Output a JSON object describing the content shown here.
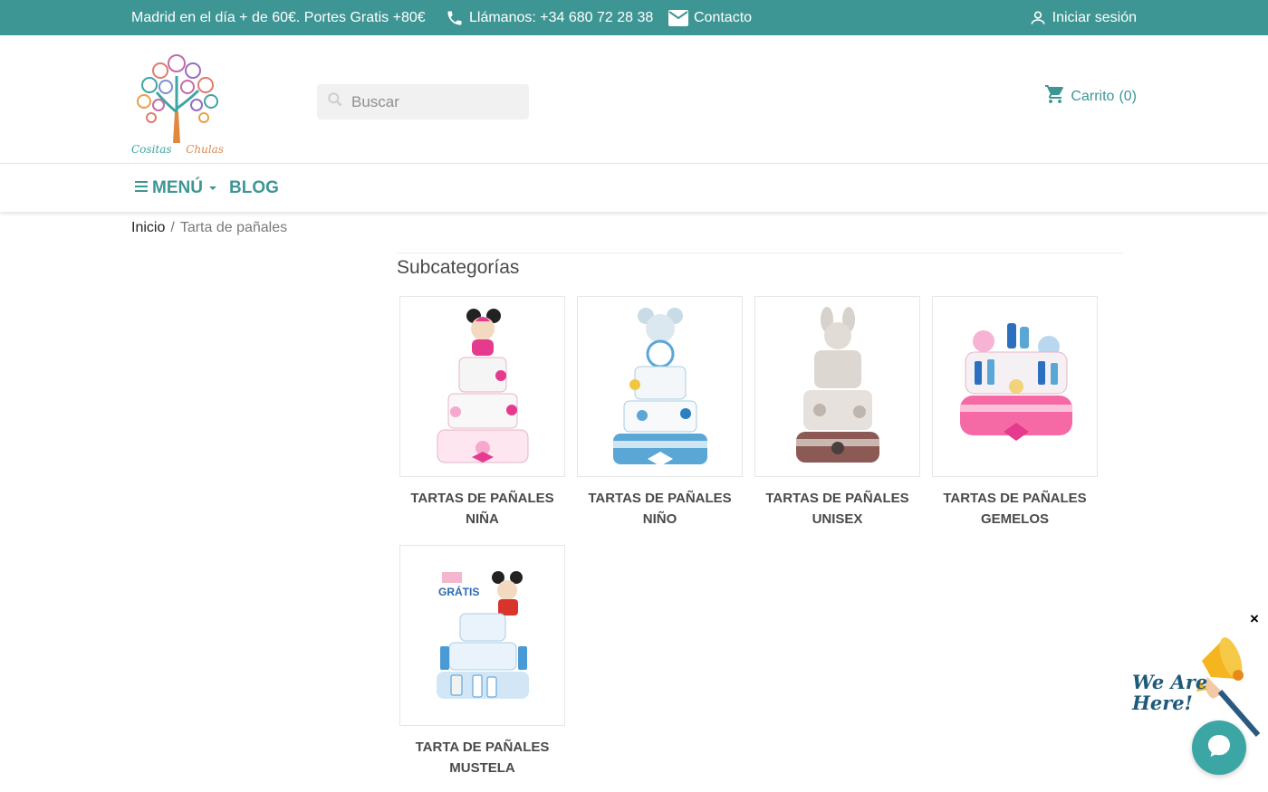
{
  "topbar": {
    "promo": "Madrid en el día + de 60€. Portes Gratis +80€",
    "phone": "Llámanos: +34 680 72 28 38",
    "contact": "Contacto",
    "login": "Iniciar sesión"
  },
  "header": {
    "logo_word1": "Cositas",
    "logo_word2": "Chulas",
    "search_placeholder": "Buscar",
    "cart_label": "Carrito",
    "cart_count": "(0)"
  },
  "nav": {
    "menu": "MENÚ",
    "blog": "BLOG"
  },
  "breadcrumb": {
    "home": "Inicio",
    "separator": "/",
    "current": "Tarta de pañales"
  },
  "subcategories": {
    "title": "Subcategorías",
    "items": [
      {
        "line1": "TARTAS DE PAÑALES",
        "line2": "NIÑA"
      },
      {
        "line1": "TARTAS DE PAÑALES",
        "line2": "NIÑO"
      },
      {
        "line1": "TARTAS DE PAÑALES",
        "line2": "UNISEX"
      },
      {
        "line1": "TARTAS DE PAÑALES",
        "line2": "GEMELOS"
      },
      {
        "line1": "TARTA DE PAÑALES",
        "line2": "MUSTELA"
      }
    ]
  },
  "chat": {
    "close": "×",
    "badge_line1": "We Are",
    "badge_line2": "Here!"
  },
  "colors": {
    "brand": "#3e9694",
    "chat": "#3ba6a3"
  }
}
